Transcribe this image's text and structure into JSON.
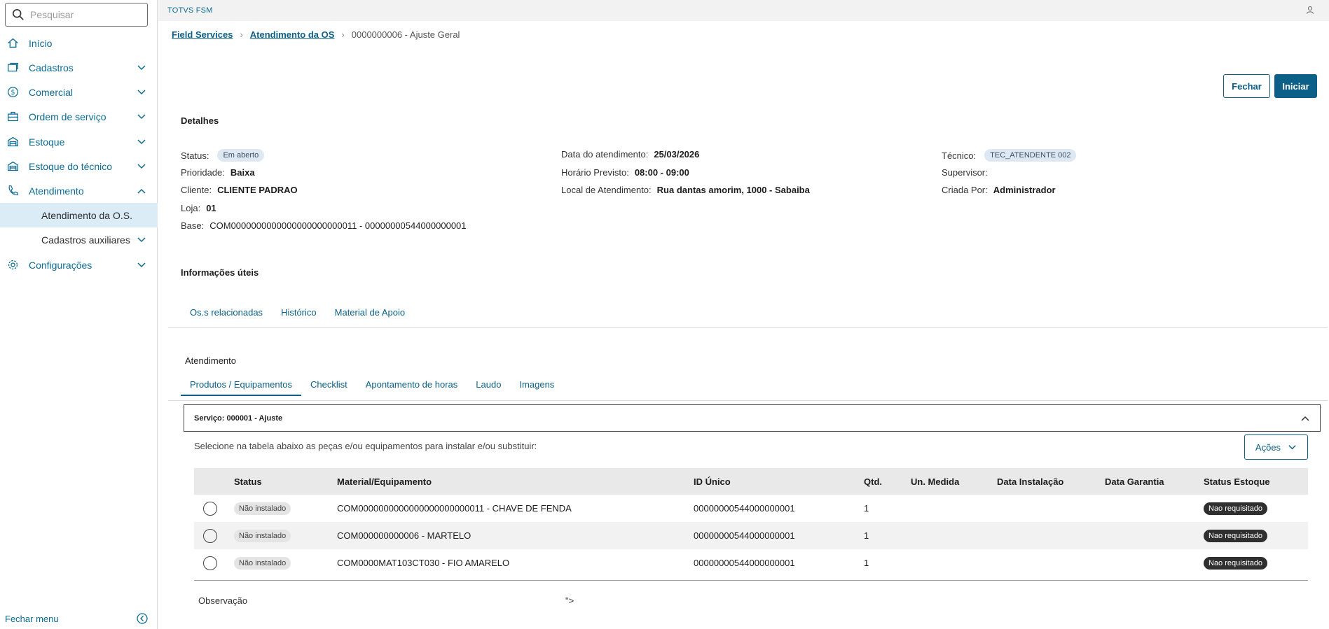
{
  "sidebar": {
    "search_placeholder": "Pesquisar",
    "items": [
      {
        "label": "Início",
        "icon": "home-icon"
      },
      {
        "label": "Cadastros",
        "icon": "card-icon"
      },
      {
        "label": "Comercial",
        "icon": "dollar-icon"
      },
      {
        "label": "Ordem de serviço",
        "icon": "briefcase-icon"
      },
      {
        "label": "Estoque",
        "icon": "warehouse-icon"
      },
      {
        "label": "Estoque do técnico",
        "icon": "warehouse-icon"
      },
      {
        "label": "Atendimento",
        "icon": "phone-icon"
      },
      {
        "label": "Atendimento da O.S."
      },
      {
        "label": "Cadastros auxiliares"
      },
      {
        "label": "Configurações",
        "icon": "gear-icon"
      }
    ],
    "footer_label": "Fechar menu"
  },
  "topbar": {
    "app_title": "TOTVS FSM"
  },
  "breadcrumb": {
    "items": [
      "Field Services",
      "Atendimento da OS"
    ],
    "current": "0000000006 - Ajuste Geral"
  },
  "actions": {
    "close_label": "Fechar",
    "start_label": "Iniciar"
  },
  "details": {
    "title": "Detalhes",
    "status_label": "Status:",
    "status_value": "Em aberto",
    "priority_label": "Prioridade:",
    "priority_value": "Baixa",
    "client_label": "Cliente:",
    "client_value": "CLIENTE PADRAO",
    "store_label": "Loja:",
    "store_value": "01",
    "base_label": "Base:",
    "base_value": "COM0000000000000000000000011 - 00000000544000000001",
    "date_label": "Data do atendimento:",
    "date_value": "25/03/2026",
    "time_label": "Horário Previsto:",
    "time_value": "08:00 - 09:00",
    "location_label": "Local de Atendimento:",
    "location_value": "Rua dantas amorim, 1000 - Sabaiba",
    "tech_label": "Técnico:",
    "tech_value": "TEC_ATENDENTE 002",
    "supervisor_label": "Supervisor:",
    "created_label": "Criada Por:",
    "created_value": "Administrador"
  },
  "info": {
    "title": "Informações úteis",
    "tabs": [
      "Os.s relacionadas",
      "Histórico",
      "Material de Apoio"
    ]
  },
  "attendance": {
    "title": "Atendimento",
    "tabs": [
      "Produtos / Equipamentos",
      "Checklist",
      "Apontamento de horas",
      "Laudo",
      "Imagens"
    ],
    "active_tab": "Produtos / Equipamentos"
  },
  "service": {
    "header": "Serviço: 000001 - Ajuste",
    "instruction": "Selecione na tabela abaixo as peças e/ou equipamentos para instalar e/ou substituir:",
    "actions_label": "Ações"
  },
  "table": {
    "columns": [
      "Status",
      "Material/Equipamento",
      "ID Único",
      "Qtd.",
      "Un. Medida",
      "Data Instalação",
      "Data Garantia",
      "Status Estoque"
    ],
    "rows": [
      {
        "status": "Não instalado",
        "material": "COM0000000000000000000000011 - CHAVE DE FENDA",
        "id": "00000000544000000001",
        "qty": "1",
        "unit": "",
        "install_date": "",
        "warranty_date": "",
        "stock_status": "Nao requisitado"
      },
      {
        "status": "Não instalado",
        "material": "COM000000000006 - MARTELO",
        "id": "00000000544000000001",
        "qty": "1",
        "unit": "",
        "install_date": "",
        "warranty_date": "",
        "stock_status": "Nao requisitado"
      },
      {
        "status": "Não instalado",
        "material": "COM0000MAT103CT030 - FIO AMARELO",
        "id": "00000000544000000001",
        "qty": "1",
        "unit": "",
        "install_date": "",
        "warranty_date": "",
        "stock_status": "Nao requisitado"
      }
    ]
  },
  "observation": {
    "label": "Observação",
    "value": "\">"
  },
  "colors": {
    "primary": "#0c5f86",
    "link": "#0c6c94",
    "active_bg": "#dcecf7"
  }
}
